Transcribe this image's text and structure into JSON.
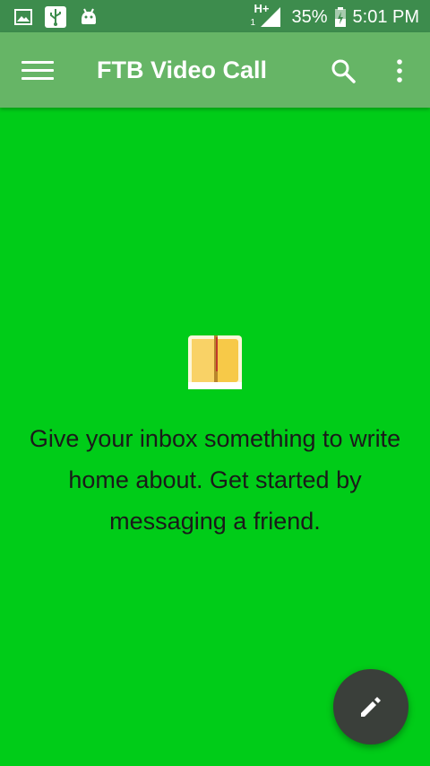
{
  "status_bar": {
    "network_type": "H+",
    "sim_indicator": "1",
    "battery": "35%",
    "time": "5:01 PM"
  },
  "app_bar": {
    "title": "FTB Video Call",
    "icons": [
      "menu-icon",
      "search-icon",
      "more-vert-icon"
    ]
  },
  "empty_state": {
    "message": "Give your inbox something to write home about. Get started by messaging a friend.",
    "icon": "inbox-envelope-icon"
  },
  "fab": {
    "icon": "pencil-icon"
  },
  "colors": {
    "background": "#00cc18",
    "app_bar": "#66b566",
    "status_bar": "#3d8c4d",
    "fab": "#3a3f3a"
  }
}
